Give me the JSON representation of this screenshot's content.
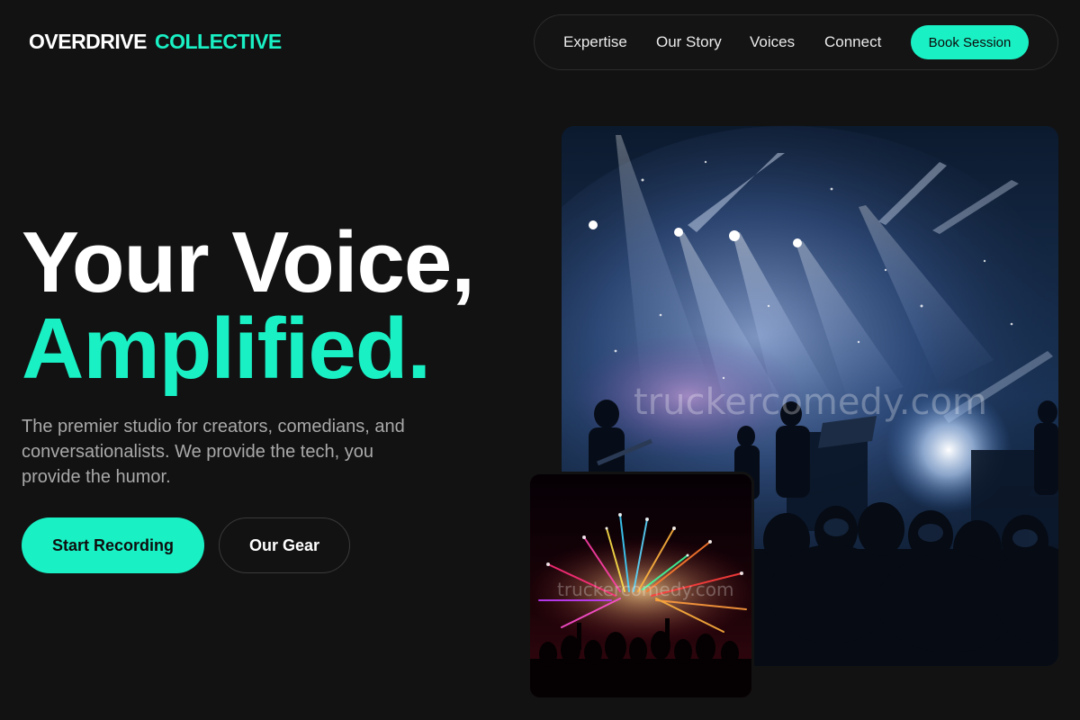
{
  "header": {
    "brand_primary": "OVERDRIVE",
    "brand_accent": "COLLECTIVE",
    "nav": [
      {
        "label": "Expertise"
      },
      {
        "label": "Our Story"
      },
      {
        "label": "Voices"
      },
      {
        "label": "Connect"
      }
    ],
    "cta_label": "Book Session"
  },
  "hero": {
    "headline": "Your Voice,",
    "headline_accent": "Amplified.",
    "description": "The premier studio for creators, comedians, and conversationalists. We provide the tech, you provide the humor.",
    "primary_button": "Start Recording",
    "secondary_button": "Our Gear"
  },
  "images": {
    "main_watermark": "truckercomedy.com",
    "inset_watermark": "truckercomedy.com"
  },
  "colors": {
    "background": "#121212",
    "accent": "#19f0c4",
    "muted_text": "#a9a9a9"
  }
}
